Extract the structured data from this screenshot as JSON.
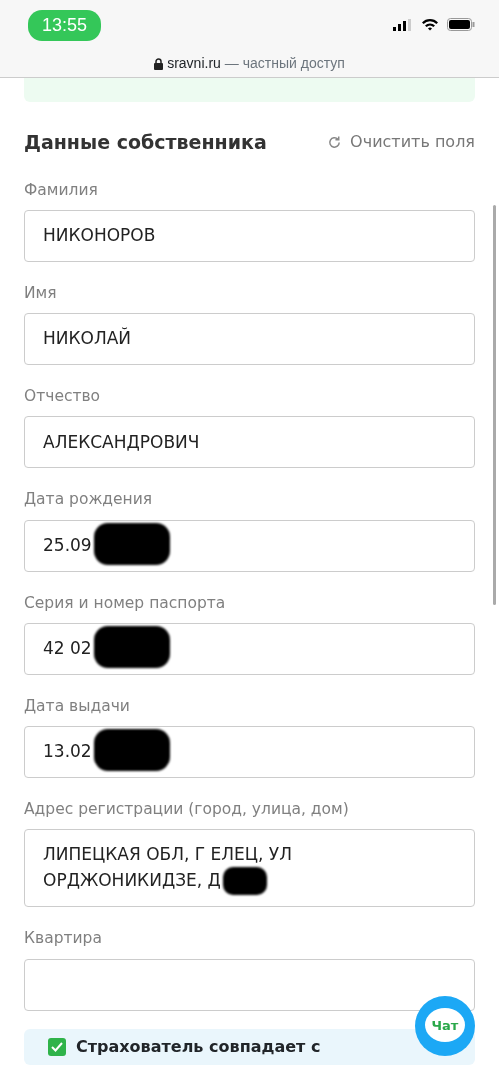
{
  "status_bar": {
    "time": "13:55"
  },
  "address_bar": {
    "domain": "sravni.ru",
    "note": "— частный доступ"
  },
  "section": {
    "title": "Данные собственника",
    "clear_link": "Очистить поля"
  },
  "fields": [
    {
      "label": "Фамилия",
      "value": "НИКОНОРОВ",
      "redacted": false
    },
    {
      "label": "Имя",
      "value": "НИКОЛАЙ",
      "redacted": false
    },
    {
      "label": "Отчество",
      "value": "АЛЕКСАНДРОВИЧ",
      "redacted": false
    },
    {
      "label": "Дата рождения",
      "value": "25.09",
      "redacted": true
    },
    {
      "label": "Серия и номер паспорта",
      "value": "42 02",
      "redacted": true
    },
    {
      "label": "Дата выдачи",
      "value": "13.02",
      "redacted": true
    },
    {
      "label": "Адрес регистрации (город, улица, дом)",
      "value": "ЛИПЕЦКАЯ ОБЛ, Г ЕЛЕЦ, УЛ ОРДЖОНИКИДЗЕ, Д",
      "redacted": true,
      "kind": "multiline"
    },
    {
      "label": "Квартира",
      "redacted": false
    }
  ],
  "chat_button": {
    "label": "Чат"
  },
  "policyholder": {
    "label": "Страхователь совпадает с",
    "checked": true
  }
}
